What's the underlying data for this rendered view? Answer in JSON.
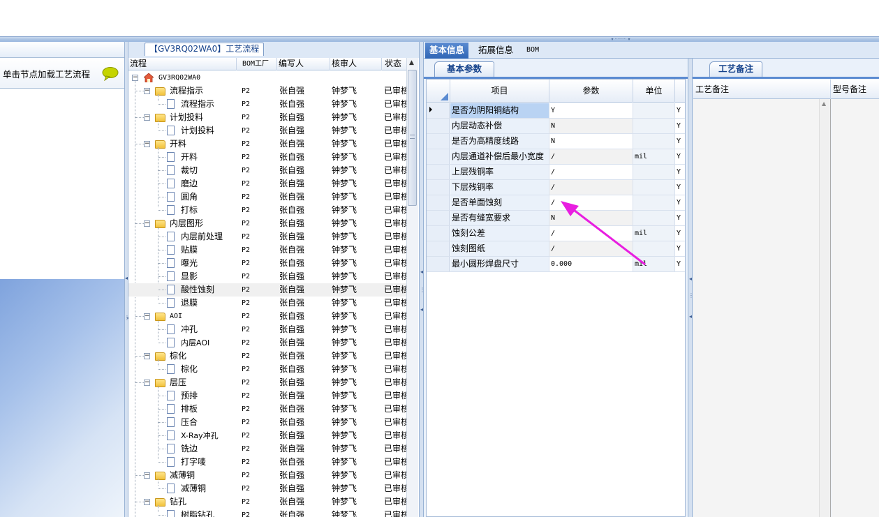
{
  "left_panel": {
    "message": "单击节点加载工艺流程"
  },
  "tree_panel": {
    "title": "【GV3RQ02WA0】工艺流程",
    "columns": [
      "流程",
      "BOM工厂",
      "编写人",
      "核审人",
      "状态"
    ],
    "root": "GV3RQ02WA0",
    "rows": [
      {
        "name": "流程指示",
        "type": "folder",
        "bom": "P2",
        "writer": "张自强",
        "reviewer": "钟梦飞",
        "status": "已审核"
      },
      {
        "name": "流程指示",
        "type": "doc",
        "bom": "P2",
        "writer": "张自强",
        "reviewer": "钟梦飞",
        "status": "已审核"
      },
      {
        "name": "计划投料",
        "type": "folder",
        "bom": "P2",
        "writer": "张自强",
        "reviewer": "钟梦飞",
        "status": "已审核"
      },
      {
        "name": "计划投料",
        "type": "doc",
        "bom": "P2",
        "writer": "张自强",
        "reviewer": "钟梦飞",
        "status": "已审核"
      },
      {
        "name": "开料",
        "type": "folder",
        "bom": "P2",
        "writer": "张自强",
        "reviewer": "钟梦飞",
        "status": "已审核"
      },
      {
        "name": "开料",
        "type": "doc",
        "bom": "P2",
        "writer": "张自强",
        "reviewer": "钟梦飞",
        "status": "已审核"
      },
      {
        "name": "裁切",
        "type": "doc",
        "bom": "P2",
        "writer": "张自强",
        "reviewer": "钟梦飞",
        "status": "已审核"
      },
      {
        "name": "磨边",
        "type": "doc",
        "bom": "P2",
        "writer": "张自强",
        "reviewer": "钟梦飞",
        "status": "已审核"
      },
      {
        "name": "圆角",
        "type": "doc",
        "bom": "P2",
        "writer": "张自强",
        "reviewer": "钟梦飞",
        "status": "已审核"
      },
      {
        "name": "打标",
        "type": "doc",
        "bom": "P2",
        "writer": "张自强",
        "reviewer": "钟梦飞",
        "status": "已审核"
      },
      {
        "name": "内层图形",
        "type": "folder",
        "bom": "P2",
        "writer": "张自强",
        "reviewer": "钟梦飞",
        "status": "已审核"
      },
      {
        "name": "内层前处理",
        "type": "doc",
        "bom": "P2",
        "writer": "张自强",
        "reviewer": "钟梦飞",
        "status": "已审核"
      },
      {
        "name": "贴膜",
        "type": "doc",
        "bom": "P2",
        "writer": "张自强",
        "reviewer": "钟梦飞",
        "status": "已审核"
      },
      {
        "name": "曝光",
        "type": "doc",
        "bom": "P2",
        "writer": "张自强",
        "reviewer": "钟梦飞",
        "status": "已审核"
      },
      {
        "name": "显影",
        "type": "doc",
        "bom": "P2",
        "writer": "张自强",
        "reviewer": "钟梦飞",
        "status": "已审核"
      },
      {
        "name": "酸性蚀刻",
        "type": "doc",
        "bom": "P2",
        "writer": "张自强",
        "reviewer": "钟梦飞",
        "status": "已审核",
        "selected": true
      },
      {
        "name": "退膜",
        "type": "doc",
        "bom": "P2",
        "writer": "张自强",
        "reviewer": "钟梦飞",
        "status": "已审核"
      },
      {
        "name": "AOI",
        "type": "folder",
        "bom": "P2",
        "writer": "张自强",
        "reviewer": "钟梦飞",
        "status": "已审核"
      },
      {
        "name": "冲孔",
        "type": "doc",
        "bom": "P2",
        "writer": "张自强",
        "reviewer": "钟梦飞",
        "status": "已审核"
      },
      {
        "name": "内层AOI",
        "type": "doc",
        "bom": "P2",
        "writer": "张自强",
        "reviewer": "钟梦飞",
        "status": "已审核"
      },
      {
        "name": "棕化",
        "type": "folder",
        "bom": "P2",
        "writer": "张自强",
        "reviewer": "钟梦飞",
        "status": "已审核"
      },
      {
        "name": "棕化",
        "type": "doc",
        "bom": "P2",
        "writer": "张自强",
        "reviewer": "钟梦飞",
        "status": "已审核"
      },
      {
        "name": "层压",
        "type": "folder",
        "bom": "P2",
        "writer": "张自强",
        "reviewer": "钟梦飞",
        "status": "已审核"
      },
      {
        "name": "预排",
        "type": "doc",
        "bom": "P2",
        "writer": "张自强",
        "reviewer": "钟梦飞",
        "status": "已审核"
      },
      {
        "name": "排板",
        "type": "doc",
        "bom": "P2",
        "writer": "张自强",
        "reviewer": "钟梦飞",
        "status": "已审核"
      },
      {
        "name": "压合",
        "type": "doc",
        "bom": "P2",
        "writer": "张自强",
        "reviewer": "钟梦飞",
        "status": "已审核"
      },
      {
        "name": "X-Ray冲孔",
        "type": "doc",
        "bom": "P2",
        "writer": "张自强",
        "reviewer": "钟梦飞",
        "status": "已审核"
      },
      {
        "name": "铣边",
        "type": "doc",
        "bom": "P2",
        "writer": "张自强",
        "reviewer": "钟梦飞",
        "status": "已审核"
      },
      {
        "name": "打字唛",
        "type": "doc",
        "bom": "P2",
        "writer": "张自强",
        "reviewer": "钟梦飞",
        "status": "已审核"
      },
      {
        "name": "减薄铜",
        "type": "folder",
        "bom": "P2",
        "writer": "张自强",
        "reviewer": "钟梦飞",
        "status": "已审核"
      },
      {
        "name": "减薄铜",
        "type": "doc",
        "bom": "P2",
        "writer": "张自强",
        "reviewer": "钟梦飞",
        "status": "已审核"
      },
      {
        "name": "钻孔",
        "type": "folder",
        "bom": "P2",
        "writer": "张自强",
        "reviewer": "钟梦飞",
        "status": "已审核"
      },
      {
        "name": "树脂钻孔",
        "type": "doc",
        "bom": "P2",
        "writer": "张自强",
        "reviewer": "钟梦飞",
        "status": "已审核"
      }
    ]
  },
  "right_tabs": [
    "基本信息",
    "拓展信息",
    "BOM"
  ],
  "basic_params": {
    "tab": "基本参数",
    "columns": [
      "项目",
      "参数",
      "单位"
    ],
    "rows": [
      {
        "item": "是否为阴阳铜结构",
        "value": "Y",
        "unit": "",
        "flag": "Y"
      },
      {
        "item": "内层动态补偿",
        "value": "N",
        "unit": "",
        "flag": "Y"
      },
      {
        "item": "是否为高精度线路",
        "value": "N",
        "unit": "",
        "flag": "Y"
      },
      {
        "item": "内层通道补偿后最小宽度",
        "value": "/",
        "unit": "mil",
        "flag": "Y"
      },
      {
        "item": "上层残铜率",
        "value": "/",
        "unit": "",
        "flag": "Y"
      },
      {
        "item": "下层残铜率",
        "value": "/",
        "unit": "",
        "flag": "Y"
      },
      {
        "item": "是否单面蚀刻",
        "value": "/",
        "unit": "",
        "flag": "Y"
      },
      {
        "item": "是否有缝宽要求",
        "value": "N",
        "unit": "",
        "flag": "Y"
      },
      {
        "item": "蚀刻公差",
        "value": "/",
        "unit": "mil",
        "flag": "Y"
      },
      {
        "item": "蚀刻图纸",
        "value": "/",
        "unit": "",
        "flag": "Y"
      },
      {
        "item": "最小圆形焊盘尺寸",
        "value": "0.000",
        "unit": "mil",
        "flag": "Y"
      }
    ]
  },
  "remarks": {
    "tab": "工艺备注",
    "columns": [
      "工艺备注",
      "型号备注"
    ]
  },
  "colors": {
    "accent": "#2f66b5",
    "arrow": "#e81ee0"
  }
}
